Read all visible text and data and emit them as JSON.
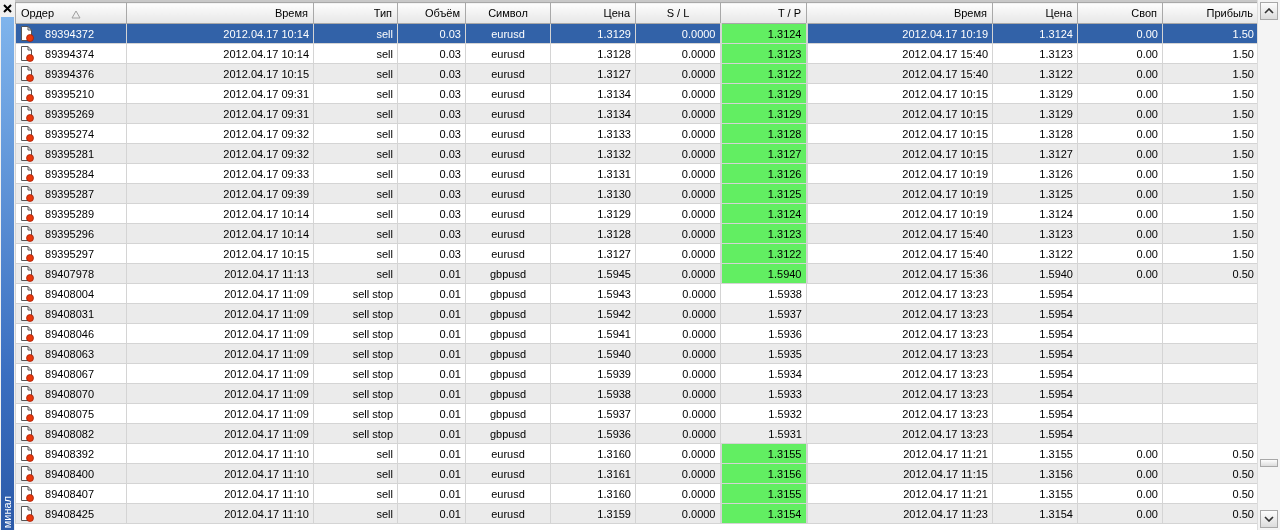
{
  "panel": {
    "title": "минал"
  },
  "table": {
    "columns": [
      {
        "label": "Ордер",
        "sorted": true
      },
      {
        "label": "Время"
      },
      {
        "label": "Тип"
      },
      {
        "label": "Объём"
      },
      {
        "label": "Символ"
      },
      {
        "label": "Цена"
      },
      {
        "label": "S / L"
      },
      {
        "label": "T / P"
      },
      {
        "label": "Время"
      },
      {
        "label": "Цена"
      },
      {
        "label": "Своп"
      },
      {
        "label": "Прибыль"
      }
    ],
    "rows": [
      {
        "selected": true,
        "tp_reached": true,
        "order": "89394372",
        "time": "2012.04.17 10:14",
        "type": "sell",
        "volume": "0.03",
        "symbol": "eurusd",
        "price": "1.3129",
        "sl": "0.0000",
        "tp": "1.3124",
        "close_time": "2012.04.17 10:19",
        "close_price": "1.3124",
        "swap": "0.00",
        "profit": "1.50"
      },
      {
        "selected": false,
        "tp_reached": true,
        "order": "89394374",
        "time": "2012.04.17 10:14",
        "type": "sell",
        "volume": "0.03",
        "symbol": "eurusd",
        "price": "1.3128",
        "sl": "0.0000",
        "tp": "1.3123",
        "close_time": "2012.04.17 15:40",
        "close_price": "1.3123",
        "swap": "0.00",
        "profit": "1.50"
      },
      {
        "selected": false,
        "tp_reached": true,
        "order": "89394376",
        "time": "2012.04.17 10:15",
        "type": "sell",
        "volume": "0.03",
        "symbol": "eurusd",
        "price": "1.3127",
        "sl": "0.0000",
        "tp": "1.3122",
        "close_time": "2012.04.17 15:40",
        "close_price": "1.3122",
        "swap": "0.00",
        "profit": "1.50"
      },
      {
        "selected": false,
        "tp_reached": true,
        "order": "89395210",
        "time": "2012.04.17 09:31",
        "type": "sell",
        "volume": "0.03",
        "symbol": "eurusd",
        "price": "1.3134",
        "sl": "0.0000",
        "tp": "1.3129",
        "close_time": "2012.04.17 10:15",
        "close_price": "1.3129",
        "swap": "0.00",
        "profit": "1.50"
      },
      {
        "selected": false,
        "tp_reached": true,
        "order": "89395269",
        "time": "2012.04.17 09:31",
        "type": "sell",
        "volume": "0.03",
        "symbol": "eurusd",
        "price": "1.3134",
        "sl": "0.0000",
        "tp": "1.3129",
        "close_time": "2012.04.17 10:15",
        "close_price": "1.3129",
        "swap": "0.00",
        "profit": "1.50"
      },
      {
        "selected": false,
        "tp_reached": true,
        "order": "89395274",
        "time": "2012.04.17 09:32",
        "type": "sell",
        "volume": "0.03",
        "symbol": "eurusd",
        "price": "1.3133",
        "sl": "0.0000",
        "tp": "1.3128",
        "close_time": "2012.04.17 10:15",
        "close_price": "1.3128",
        "swap": "0.00",
        "profit": "1.50"
      },
      {
        "selected": false,
        "tp_reached": true,
        "order": "89395281",
        "time": "2012.04.17 09:32",
        "type": "sell",
        "volume": "0.03",
        "symbol": "eurusd",
        "price": "1.3132",
        "sl": "0.0000",
        "tp": "1.3127",
        "close_time": "2012.04.17 10:15",
        "close_price": "1.3127",
        "swap": "0.00",
        "profit": "1.50"
      },
      {
        "selected": false,
        "tp_reached": true,
        "order": "89395284",
        "time": "2012.04.17 09:33",
        "type": "sell",
        "volume": "0.03",
        "symbol": "eurusd",
        "price": "1.3131",
        "sl": "0.0000",
        "tp": "1.3126",
        "close_time": "2012.04.17 10:19",
        "close_price": "1.3126",
        "swap": "0.00",
        "profit": "1.50"
      },
      {
        "selected": false,
        "tp_reached": true,
        "order": "89395287",
        "time": "2012.04.17 09:39",
        "type": "sell",
        "volume": "0.03",
        "symbol": "eurusd",
        "price": "1.3130",
        "sl": "0.0000",
        "tp": "1.3125",
        "close_time": "2012.04.17 10:19",
        "close_price": "1.3125",
        "swap": "0.00",
        "profit": "1.50"
      },
      {
        "selected": false,
        "tp_reached": true,
        "order": "89395289",
        "time": "2012.04.17 10:14",
        "type": "sell",
        "volume": "0.03",
        "symbol": "eurusd",
        "price": "1.3129",
        "sl": "0.0000",
        "tp": "1.3124",
        "close_time": "2012.04.17 10:19",
        "close_price": "1.3124",
        "swap": "0.00",
        "profit": "1.50"
      },
      {
        "selected": false,
        "tp_reached": true,
        "order": "89395296",
        "time": "2012.04.17 10:14",
        "type": "sell",
        "volume": "0.03",
        "symbol": "eurusd",
        "price": "1.3128",
        "sl": "0.0000",
        "tp": "1.3123",
        "close_time": "2012.04.17 15:40",
        "close_price": "1.3123",
        "swap": "0.00",
        "profit": "1.50"
      },
      {
        "selected": false,
        "tp_reached": true,
        "order": "89395297",
        "time": "2012.04.17 10:15",
        "type": "sell",
        "volume": "0.03",
        "symbol": "eurusd",
        "price": "1.3127",
        "sl": "0.0000",
        "tp": "1.3122",
        "close_time": "2012.04.17 15:40",
        "close_price": "1.3122",
        "swap": "0.00",
        "profit": "1.50"
      },
      {
        "selected": false,
        "tp_reached": true,
        "order": "89407978",
        "time": "2012.04.17 11:13",
        "type": "sell",
        "volume": "0.01",
        "symbol": "gbpusd",
        "price": "1.5945",
        "sl": "0.0000",
        "tp": "1.5940",
        "close_time": "2012.04.17 15:36",
        "close_price": "1.5940",
        "swap": "0.00",
        "profit": "0.50"
      },
      {
        "selected": false,
        "tp_reached": false,
        "order": "89408004",
        "time": "2012.04.17 11:09",
        "type": "sell stop",
        "volume": "0.01",
        "symbol": "gbpusd",
        "price": "1.5943",
        "sl": "0.0000",
        "tp": "1.5938",
        "close_time": "2012.04.17 13:23",
        "close_price": "1.5954"
      },
      {
        "selected": false,
        "tp_reached": false,
        "order": "89408031",
        "time": "2012.04.17 11:09",
        "type": "sell stop",
        "volume": "0.01",
        "symbol": "gbpusd",
        "price": "1.5942",
        "sl": "0.0000",
        "tp": "1.5937",
        "close_time": "2012.04.17 13:23",
        "close_price": "1.5954"
      },
      {
        "selected": false,
        "tp_reached": false,
        "order": "89408046",
        "time": "2012.04.17 11:09",
        "type": "sell stop",
        "volume": "0.01",
        "symbol": "gbpusd",
        "price": "1.5941",
        "sl": "0.0000",
        "tp": "1.5936",
        "close_time": "2012.04.17 13:23",
        "close_price": "1.5954"
      },
      {
        "selected": false,
        "tp_reached": false,
        "order": "89408063",
        "time": "2012.04.17 11:09",
        "type": "sell stop",
        "volume": "0.01",
        "symbol": "gbpusd",
        "price": "1.5940",
        "sl": "0.0000",
        "tp": "1.5935",
        "close_time": "2012.04.17 13:23",
        "close_price": "1.5954"
      },
      {
        "selected": false,
        "tp_reached": false,
        "order": "89408067",
        "time": "2012.04.17 11:09",
        "type": "sell stop",
        "volume": "0.01",
        "symbol": "gbpusd",
        "price": "1.5939",
        "sl": "0.0000",
        "tp": "1.5934",
        "close_time": "2012.04.17 13:23",
        "close_price": "1.5954"
      },
      {
        "selected": false,
        "tp_reached": false,
        "order": "89408070",
        "time": "2012.04.17 11:09",
        "type": "sell stop",
        "volume": "0.01",
        "symbol": "gbpusd",
        "price": "1.5938",
        "sl": "0.0000",
        "tp": "1.5933",
        "close_time": "2012.04.17 13:23",
        "close_price": "1.5954"
      },
      {
        "selected": false,
        "tp_reached": false,
        "order": "89408075",
        "time": "2012.04.17 11:09",
        "type": "sell stop",
        "volume": "0.01",
        "symbol": "gbpusd",
        "price": "1.5937",
        "sl": "0.0000",
        "tp": "1.5932",
        "close_time": "2012.04.17 13:23",
        "close_price": "1.5954"
      },
      {
        "selected": false,
        "tp_reached": false,
        "order": "89408082",
        "time": "2012.04.17 11:09",
        "type": "sell stop",
        "volume": "0.01",
        "symbol": "gbpusd",
        "price": "1.5936",
        "sl": "0.0000",
        "tp": "1.5931",
        "close_time": "2012.04.17 13:23",
        "close_price": "1.5954"
      },
      {
        "selected": false,
        "tp_reached": true,
        "order": "89408392",
        "time": "2012.04.17 11:10",
        "type": "sell",
        "volume": "0.01",
        "symbol": "eurusd",
        "price": "1.3160",
        "sl": "0.0000",
        "tp": "1.3155",
        "close_time": "2012.04.17 11:21",
        "close_price": "1.3155",
        "swap": "0.00",
        "profit": "0.50"
      },
      {
        "selected": false,
        "tp_reached": true,
        "order": "89408400",
        "time": "2012.04.17 11:10",
        "type": "sell",
        "volume": "0.01",
        "symbol": "eurusd",
        "price": "1.3161",
        "sl": "0.0000",
        "tp": "1.3156",
        "close_time": "2012.04.17 11:15",
        "close_price": "1.3156",
        "swap": "0.00",
        "profit": "0.50"
      },
      {
        "selected": false,
        "tp_reached": true,
        "order": "89408407",
        "time": "2012.04.17 11:10",
        "type": "sell",
        "volume": "0.01",
        "symbol": "eurusd",
        "price": "1.3160",
        "sl": "0.0000",
        "tp": "1.3155",
        "close_time": "2012.04.17 11:21",
        "close_price": "1.3155",
        "swap": "0.00",
        "profit": "0.50"
      },
      {
        "selected": false,
        "tp_reached": true,
        "order": "89408425",
        "time": "2012.04.17 11:10",
        "type": "sell",
        "volume": "0.01",
        "symbol": "eurusd",
        "price": "1.3159",
        "sl": "0.0000",
        "tp": "1.3154",
        "close_time": "2012.04.17 11:23",
        "close_price": "1.3154",
        "swap": "0.00",
        "profit": "0.50"
      }
    ]
  }
}
